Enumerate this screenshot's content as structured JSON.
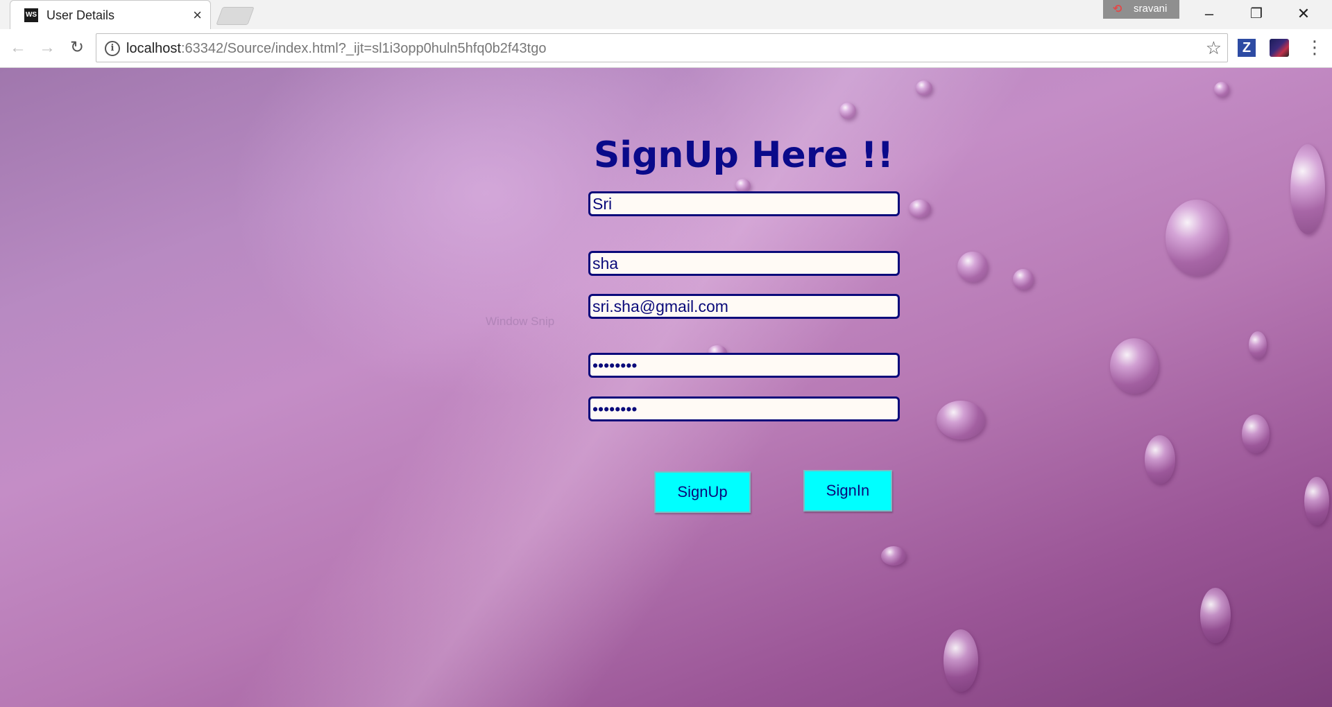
{
  "browser": {
    "tab_title": "User Details",
    "tab_favicon": "WS",
    "tab_close": "×",
    "profile_name": "sravani",
    "url_host": "localhost",
    "url_rest": ":63342/Source/index.html?_ijt=sl1i3opp0huln5hfq0b2f43tgo",
    "ext_z_label": "Z",
    "icons": [
      "back-icon",
      "forward-icon",
      "reload-icon",
      "info-icon",
      "star-icon",
      "menu-icon",
      "minimize-icon",
      "restore-icon",
      "close-icon"
    ]
  },
  "page": {
    "title": "SignUp Here !!",
    "ghost_text": "Window Snip",
    "fields": {
      "first_name": "Sri",
      "last_name": "sha",
      "email": "sri.sha@gmail.com",
      "password": "........",
      "confirm_password": "........"
    },
    "buttons": {
      "signup": "SignUp",
      "signin": "SignIn"
    },
    "colors": {
      "title": "#0a0a8a",
      "button_bg": "#00ffff",
      "field_border": "#0a0a7a"
    }
  }
}
